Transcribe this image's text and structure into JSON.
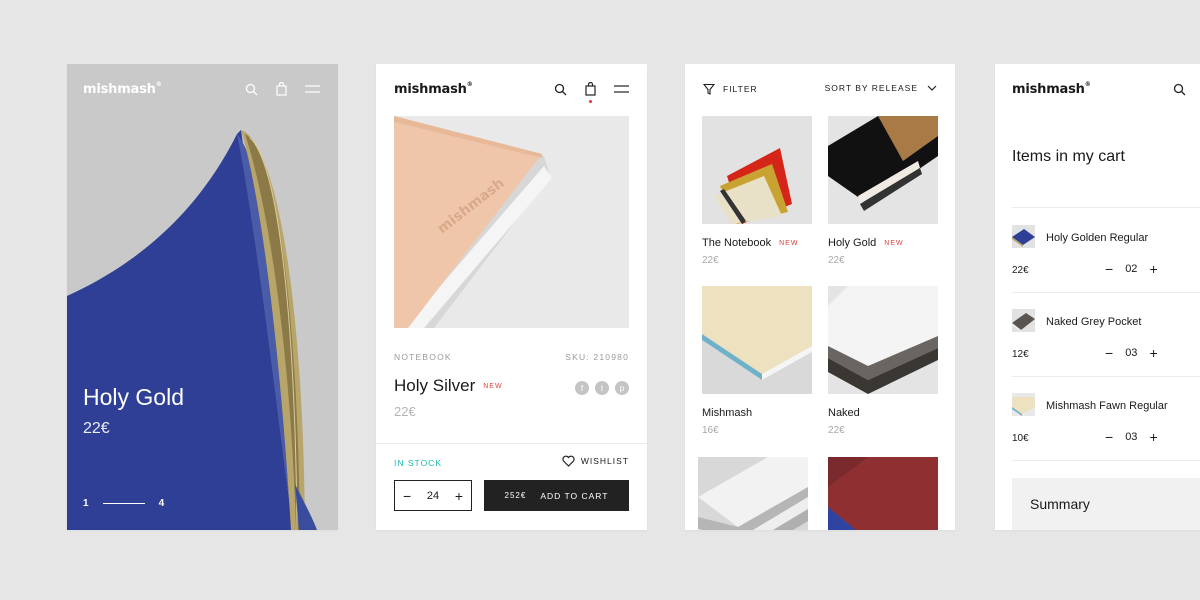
{
  "brand": "mishmash",
  "brand_mark": "®",
  "hero": {
    "title": "Holy Gold",
    "price": "22€",
    "page_current": "1",
    "page_total": "4"
  },
  "product": {
    "category": "NOTEBOOK",
    "sku": "SKU: 210980",
    "title": "Holy Silver",
    "new_badge": "NEW",
    "price": "22€",
    "stock": "IN STOCK",
    "wishlist": "WISHLIST",
    "quantity": "24",
    "cart_price": "252€",
    "add_to_cart": "ADD TO CART",
    "social_icons": [
      "facebook-icon",
      "twitter-icon",
      "pinterest-icon"
    ]
  },
  "listing": {
    "filter": "FILTER",
    "sort": "SORT BY RELEASE",
    "products": [
      {
        "name": "The Notebook",
        "badge": "NEW",
        "price": "22€"
      },
      {
        "name": "Holy Gold",
        "badge": "NEW",
        "price": "22€"
      },
      {
        "name": "Mishmash",
        "badge": "",
        "price": "16€"
      },
      {
        "name": "Naked",
        "badge": "",
        "price": "22€"
      }
    ]
  },
  "cart": {
    "title": "Items in my cart",
    "items": [
      {
        "name": "Holy Golden Regular",
        "price": "22€",
        "qty": "02"
      },
      {
        "name": "Naked Grey Pocket",
        "price": "12€",
        "qty": "03"
      },
      {
        "name": "Mishmash Fawn Regular",
        "price": "10€",
        "qty": "03"
      }
    ],
    "summary": "Summary"
  },
  "colors": {
    "accent_red": "#e0433b",
    "stock_teal": "#1fb8b0",
    "dark_button": "#222222",
    "background": "#e6e6e6"
  }
}
